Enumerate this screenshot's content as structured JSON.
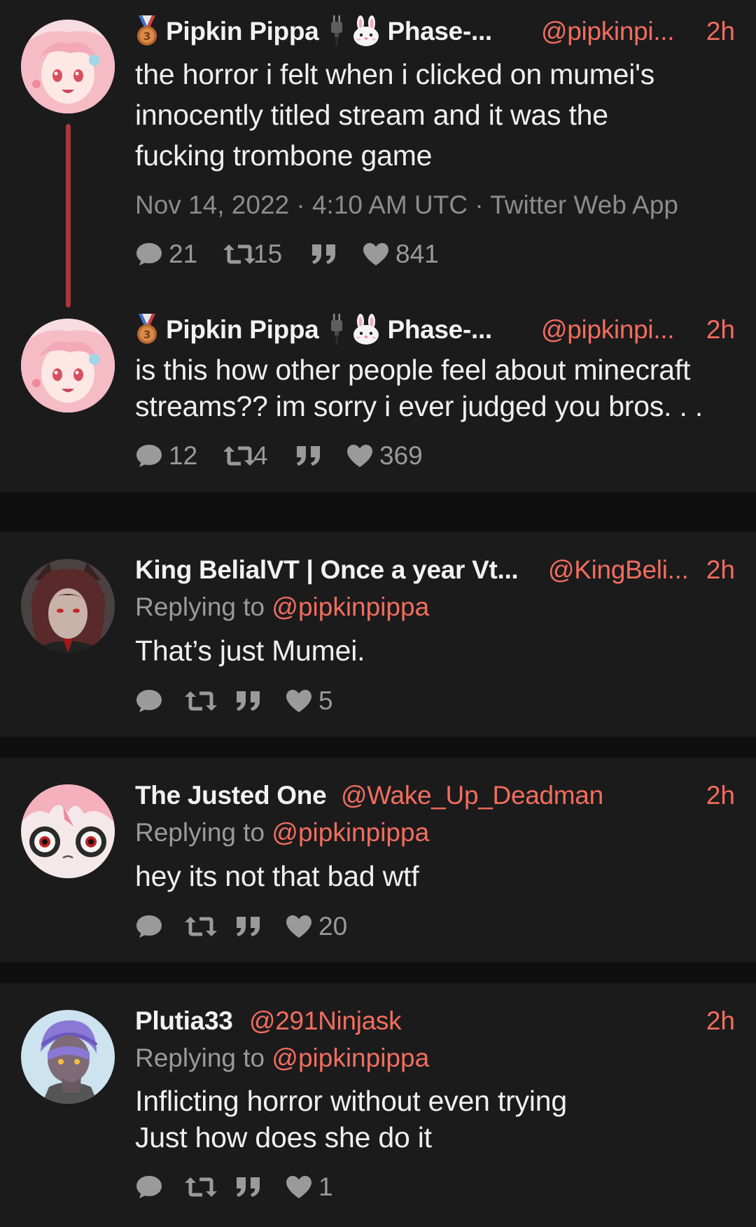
{
  "accent_color": "#f26d5e",
  "background_color": "#0f0f0f",
  "card_color": "#1b1b1c",
  "tweets": [
    {
      "name": "Pipkin Pippa",
      "name_suffix": "Phase-...",
      "handle": "@pipkinpi...",
      "time": "2h",
      "text_lines": [
        "the horror i felt when i clicked on mumei's",
        "innocently titled stream and it was the",
        "fucking trombone game"
      ],
      "meta": "Nov 14, 2022 · 4:10 AM UTC · Twitter Web App",
      "stats": {
        "replies": "21",
        "retweets": "15",
        "quotes": "",
        "likes": "841"
      },
      "icons": [
        "medal-icon",
        "plug-icon",
        "bunny-icon"
      ]
    },
    {
      "name": "Pipkin Pippa",
      "name_suffix": "Phase-...",
      "handle": "@pipkinpi...",
      "time": "2h",
      "text_lines": [
        "is this how other people feel about minecraft",
        "streams?? im sorry i ever judged you bros. . ."
      ],
      "stats": {
        "replies": "12",
        "retweets": "4",
        "quotes": "",
        "likes": "369"
      },
      "icons": [
        "medal-icon",
        "plug-icon",
        "bunny-icon"
      ]
    },
    {
      "name": "King BelialVT | Once a year Vt...",
      "handle": "@KingBeli...",
      "time": "2h",
      "replying_label": "Replying to",
      "replying_to": "@pipkinpippa",
      "text_lines": [
        "That’s just Mumei."
      ],
      "stats": {
        "replies": "",
        "retweets": "",
        "quotes": "",
        "likes": "5"
      }
    },
    {
      "name": "The Justed One",
      "handle": "@Wake_Up_Deadman",
      "time": "2h",
      "replying_label": "Replying to",
      "replying_to": "@pipkinpippa",
      "text_lines": [
        "hey its not that bad wtf"
      ],
      "stats": {
        "replies": "",
        "retweets": "",
        "quotes": "",
        "likes": "20"
      }
    },
    {
      "name": "Plutia33",
      "handle": "@291Ninjask",
      "time": "2h",
      "replying_label": "Replying to",
      "replying_to": "@pipkinpippa",
      "text_lines": [
        "Inflicting horror without even trying",
        "Just how does she do it"
      ],
      "stats": {
        "replies": "",
        "retweets": "",
        "quotes": "",
        "likes": "1"
      }
    }
  ]
}
